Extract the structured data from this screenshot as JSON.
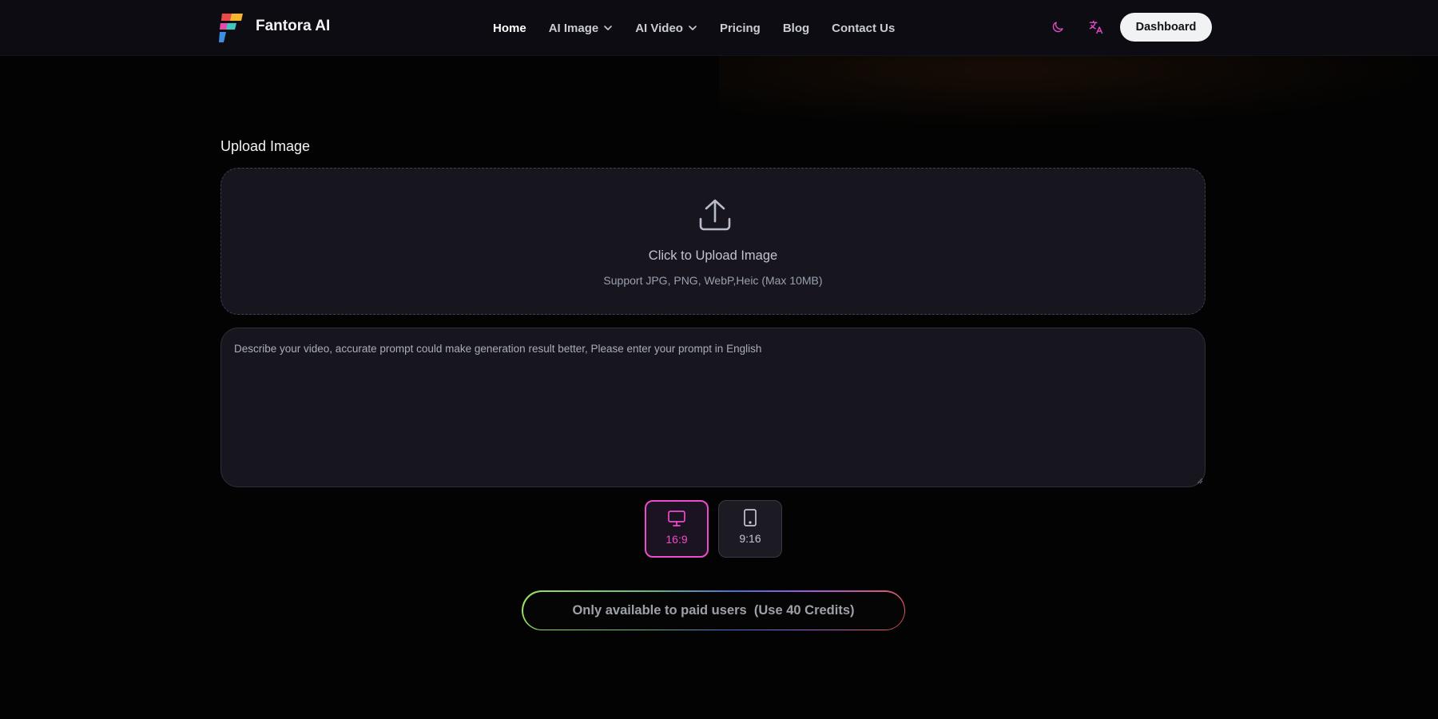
{
  "brand": {
    "name": "Fantora AI"
  },
  "nav": {
    "home": "Home",
    "ai_image": "AI Image",
    "ai_video": "AI Video",
    "pricing": "Pricing",
    "blog": "Blog",
    "contact": "Contact Us"
  },
  "header_actions": {
    "theme_icon": "moon-icon",
    "language_icon": "translate-icon",
    "dashboard_label": "Dashboard"
  },
  "upload": {
    "title": "Upload Image",
    "label": "Click to Upload Image",
    "hint": "Support JPG, PNG, WebP,Heic (Max 10MB)"
  },
  "prompt": {
    "value": "",
    "placeholder": "Describe your video, accurate prompt could make generation result better, Please enter your prompt in English"
  },
  "aspect_ratios": [
    {
      "label": "16:9",
      "icon": "monitor-icon",
      "selected": true
    },
    {
      "label": "9:16",
      "icon": "tablet-icon",
      "selected": false
    }
  ],
  "cta": {
    "label": "Only available to paid users  (Use 40 Credits)"
  },
  "colors": {
    "accent": "#ec4cc9",
    "background": "#030303",
    "panel": "#17161f"
  }
}
